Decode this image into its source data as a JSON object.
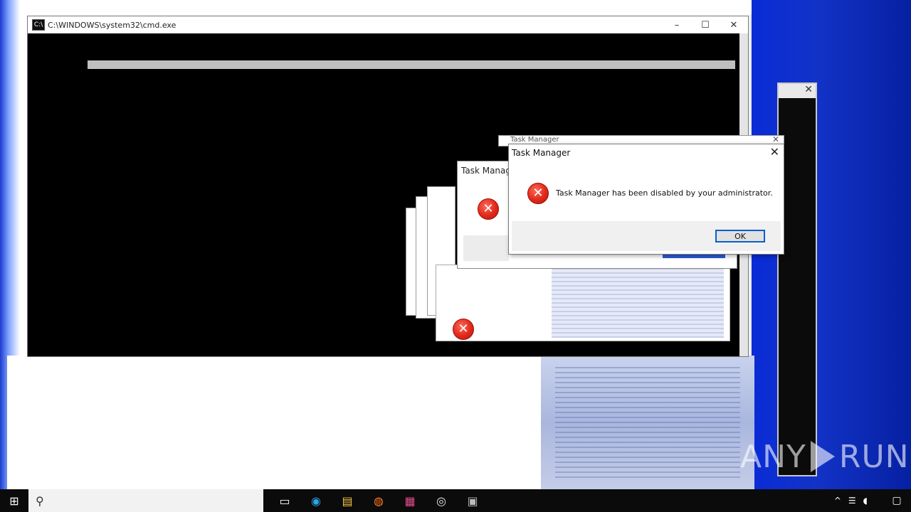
{
  "console": {
    "title": "C:\\WINDOWS\\system32\\cmd.exe",
    "icon_glyph": "C:\\",
    "line": "",
    "controls": [
      "–",
      "☐",
      "✕"
    ]
  },
  "ghost_back_dialog": {
    "title": "Task Manager"
  },
  "ghost_dialog": {
    "title": "Task Manager"
  },
  "dialog": {
    "title": "Task Manager",
    "close": "✕",
    "message": "Task Manager has been disabled by your administrator.",
    "ok_label": "OK"
  },
  "watermark": {
    "left": "ANY",
    "right": "RUN"
  },
  "taskbar": {
    "start_glyph": "⊞",
    "search_glyph": "⚲",
    "search_placeholder": "",
    "icons": [
      {
        "name": "task-view-icon",
        "glyph": "▭"
      },
      {
        "name": "edge-icon",
        "glyph": "◉"
      },
      {
        "name": "file-explorer-icon",
        "glyph": "▤"
      },
      {
        "name": "firefox-icon",
        "glyph": "◍"
      },
      {
        "name": "store-icon",
        "glyph": "▦"
      },
      {
        "name": "chrome-icon",
        "glyph": "◎"
      },
      {
        "name": "app-icon",
        "glyph": "▣"
      }
    ],
    "tray": {
      "chevron": "^",
      "network": "☰",
      "speaker": "◖",
      "clock_time": "",
      "clock_date": "",
      "notification": "▢"
    }
  },
  "colors": {
    "error_red": "#e0281a",
    "button_focus": "#0a5dcc",
    "taskbar": "#0b0b0b"
  }
}
